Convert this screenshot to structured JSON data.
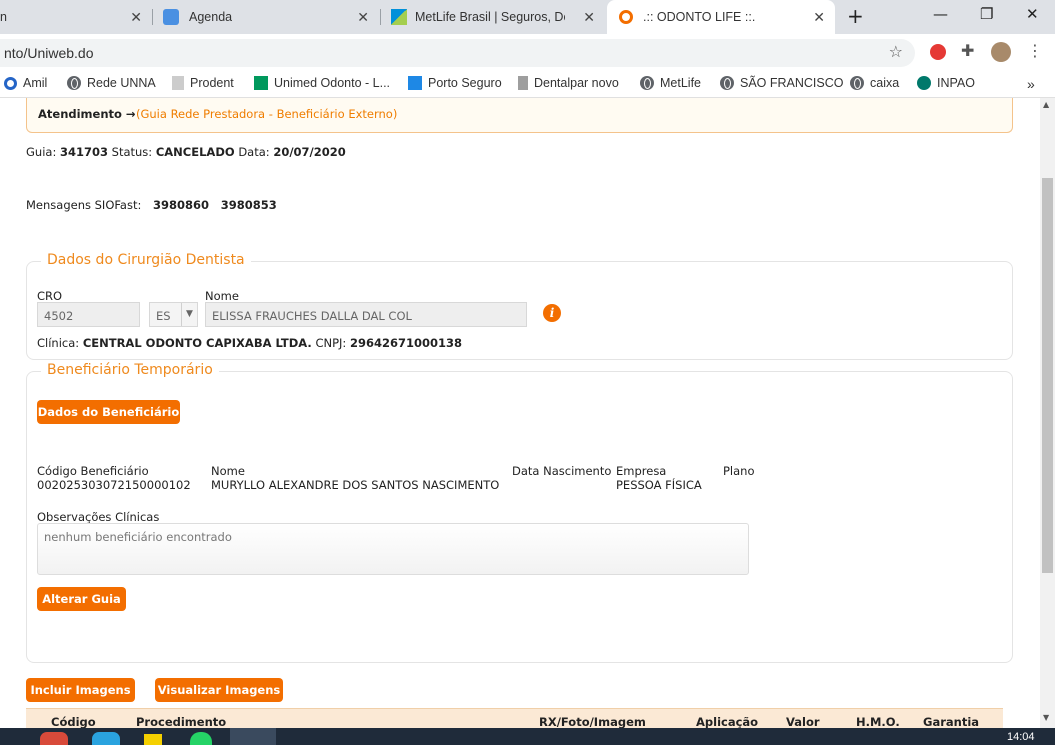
{
  "browser": {
    "tabs": [
      {
        "title": "n",
        "close": "✕"
      },
      {
        "title": "Agenda",
        "close": "✕"
      },
      {
        "title": "MetLife Brasil | Seguros, Dental",
        "close": "✕"
      },
      {
        "title": ".:: ODONTO LIFE ::.",
        "close": "✕"
      }
    ],
    "new_tab": "+",
    "url": "nto/Uniweb.do",
    "bookmarks": [
      "Amil",
      "Rede UNNA",
      "Prodent",
      "Unimed Odonto - L...",
      "Porto Seguro",
      "Dentalpar novo",
      "MetLife",
      "SÃO FRANCISCO",
      "caixa",
      "INPAO"
    ],
    "bookmarks_more": "»",
    "window": {
      "minimize": "—",
      "restore": "❐",
      "close": "✕"
    }
  },
  "header": {
    "label": "Atendimento →",
    "sub": "(Guia Rede Prestadora - Beneficiário Externo)"
  },
  "guia": {
    "label": "Guia:",
    "number": "341703",
    "status_label": "Status:",
    "status": "CANCELADO",
    "date_label": "Data:",
    "date": "20/07/2020"
  },
  "messages": {
    "label": "Mensagens SIOFast:",
    "m1": "3980860",
    "m2": "3980853"
  },
  "dentist": {
    "legend": "Dados do Cirurgião Dentista",
    "cro_label": "CRO",
    "cro": "4502",
    "uf": "ES",
    "name_label": "Nome",
    "name": "ELISSA FRAUCHES DALLA DAL COL",
    "clinic_label": "Clínica:",
    "clinic": "CENTRAL ODONTO CAPIXABA LTDA.",
    "cnpj_label": "CNPJ:",
    "cnpj": "29642671000138"
  },
  "beneficiary": {
    "legend": "Beneficiário Temporário",
    "data_button": "Dados do Beneficiário",
    "code_label": "Código Beneficiário",
    "code": "002025303072150000102",
    "name_label": "Nome",
    "name": "MURYLLO ALEXANDRE DOS SANTOS NASCIMENTO",
    "birth_label": "Data Nascimento",
    "company_label": "Empresa",
    "company": "PESSOA FÍSICA",
    "plan_label": "Plano",
    "obs_label": "Observações Clínicas",
    "obs_placeholder": "nenhum beneficiário encontrado",
    "alter_button": "Alterar Guia"
  },
  "images": {
    "include_button": "Incluir Imagens",
    "view_button": "Visualizar Imagens"
  },
  "table": {
    "headers": [
      "Código",
      "Procedimento",
      "RX/Foto/Imagem",
      "Aplicação",
      "Valor",
      "H.M.O.",
      "Garantia"
    ]
  },
  "taskbar": {
    "time": "14:04"
  },
  "colors": {
    "accent": "#f36e00",
    "legend": "#ef8a1e"
  }
}
